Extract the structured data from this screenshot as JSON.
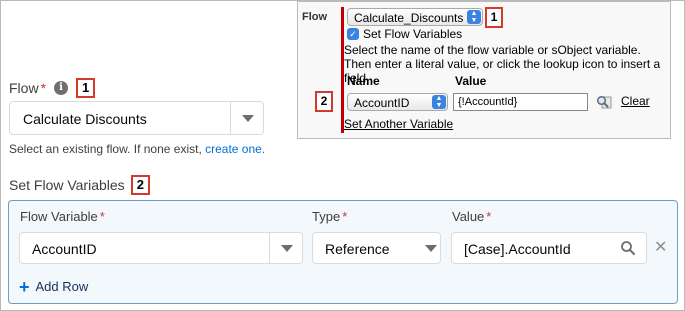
{
  "form": {
    "flow_label": "Flow",
    "required_marker": "*",
    "info_icon": "i",
    "callout_1": "1",
    "flow_value": "Calculate Discounts",
    "help_prefix": "Select an existing flow. If none exist,",
    "help_link": "create one.",
    "set_vars_label": "Set Flow Variables",
    "callout_2": "2",
    "columns": {
      "flow_variable": "Flow Variable",
      "type": "Type",
      "value": "Value"
    },
    "row": {
      "flow_variable": "AccountID",
      "type": "Reference",
      "value": "[Case].AccountId"
    },
    "add_row_label": "Add Row"
  },
  "classic": {
    "flow_label": "Flow",
    "flow_value": "Calculate_Discounts",
    "callout_1": "1",
    "checkbox_label": "Set Flow Variables",
    "description": "Select the name of the flow variable or sObject variable. Then enter a literal value, or click the lookup icon to insert a field.",
    "name_header": "Name",
    "value_header": "Value",
    "callout_2": "2",
    "name_value": "AccountID",
    "value_value": "{!AccountId}",
    "clear_label": "Clear",
    "set_another_label": "Set Another Variable"
  },
  "icons": {
    "info": "info-icon",
    "caret": "chevron-down-icon",
    "search": "search-icon",
    "remove": "close-icon",
    "add": "plus-icon",
    "lookup": "lookup-icon"
  },
  "colors": {
    "accent": "#0070d2",
    "required": "#c23934",
    "callout_border": "#d23a2c",
    "classic_bar": "#c00000",
    "vars_box_border": "#6b9ec5",
    "vars_box_bg": "#f3f8fc"
  }
}
